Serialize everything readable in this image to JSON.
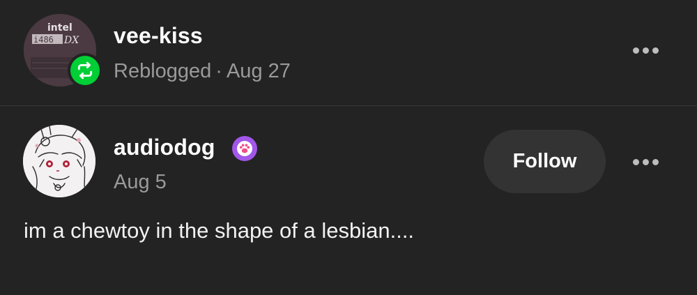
{
  "reblog": {
    "username": "vee-kiss",
    "action": "Reblogged",
    "separator": "·",
    "date": "Aug 27",
    "avatar_text_top": "intel",
    "avatar_text_model": "i486",
    "avatar_text_suffix": "DX",
    "more_icon": "more-horizontal-icon",
    "badge_icon": "reblog-icon",
    "badge_color": "#01cf35"
  },
  "post": {
    "username": "audiodog",
    "date": "Aug 5",
    "follow_label": "Follow",
    "body": "im a chewtoy in the shape of a lesbian....",
    "badge_icon": "paw-icon",
    "badge_color": "#a257e8",
    "more_icon": "more-horizontal-icon"
  },
  "colors": {
    "background": "#232323",
    "secondary_text": "#9a9a9a",
    "follow_button_bg": "#333333",
    "divider": "#3a3a3a"
  }
}
